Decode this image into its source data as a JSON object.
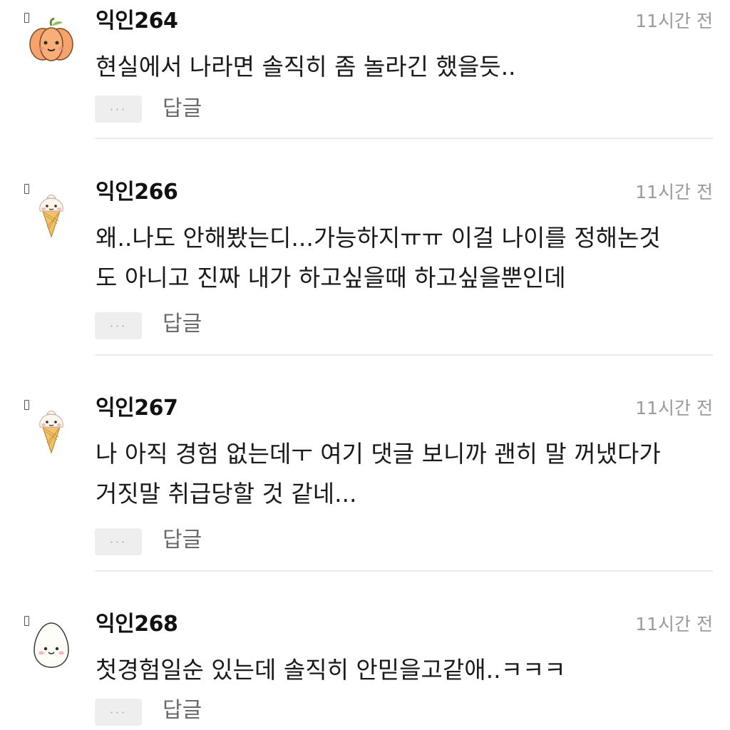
{
  "comments": [
    {
      "author": "익인264",
      "time": "11시간 전",
      "avatar_icon": "pumpkin-icon",
      "lines": [
        "현실에서 나라면 솔직히 좀 놀라긴 했을듯.."
      ],
      "more_label": "···",
      "reply_label": "답글"
    },
    {
      "author": "익인266",
      "time": "11시간 전",
      "avatar_icon": "ice-cream-icon",
      "lines": [
        "왜..나도 안해봤는디...가능하지ㅠㅠ 이걸 나이를 정해논것",
        "도 아니고 진짜 내가 하고싶을때 하고싶을뿐인데"
      ],
      "more_label": "···",
      "reply_label": "답글"
    },
    {
      "author": "익인267",
      "time": "11시간 전",
      "avatar_icon": "ice-cream-icon",
      "lines": [
        "나 아직 경험 없는데ㅜ 여기 댓글 보니까 괜히 말 꺼냈다가",
        "거짓말 취급당할 것 같네..."
      ],
      "more_label": "···",
      "reply_label": "답글"
    },
    {
      "author": "익인268",
      "time": "11시간 전",
      "avatar_icon": "egg-icon",
      "lines": [
        "첫경험일순 있는데 솔직히 안믿을고같애..ㅋㅋㅋ"
      ],
      "more_label": "···",
      "reply_label": "답글"
    }
  ],
  "colors": {
    "author": "#111111",
    "time": "#9a9a9a",
    "body": "#1a1a1a",
    "reply": "#6a6a6a",
    "more_bg": "#eeeeee",
    "divider": "#ebebeb"
  }
}
